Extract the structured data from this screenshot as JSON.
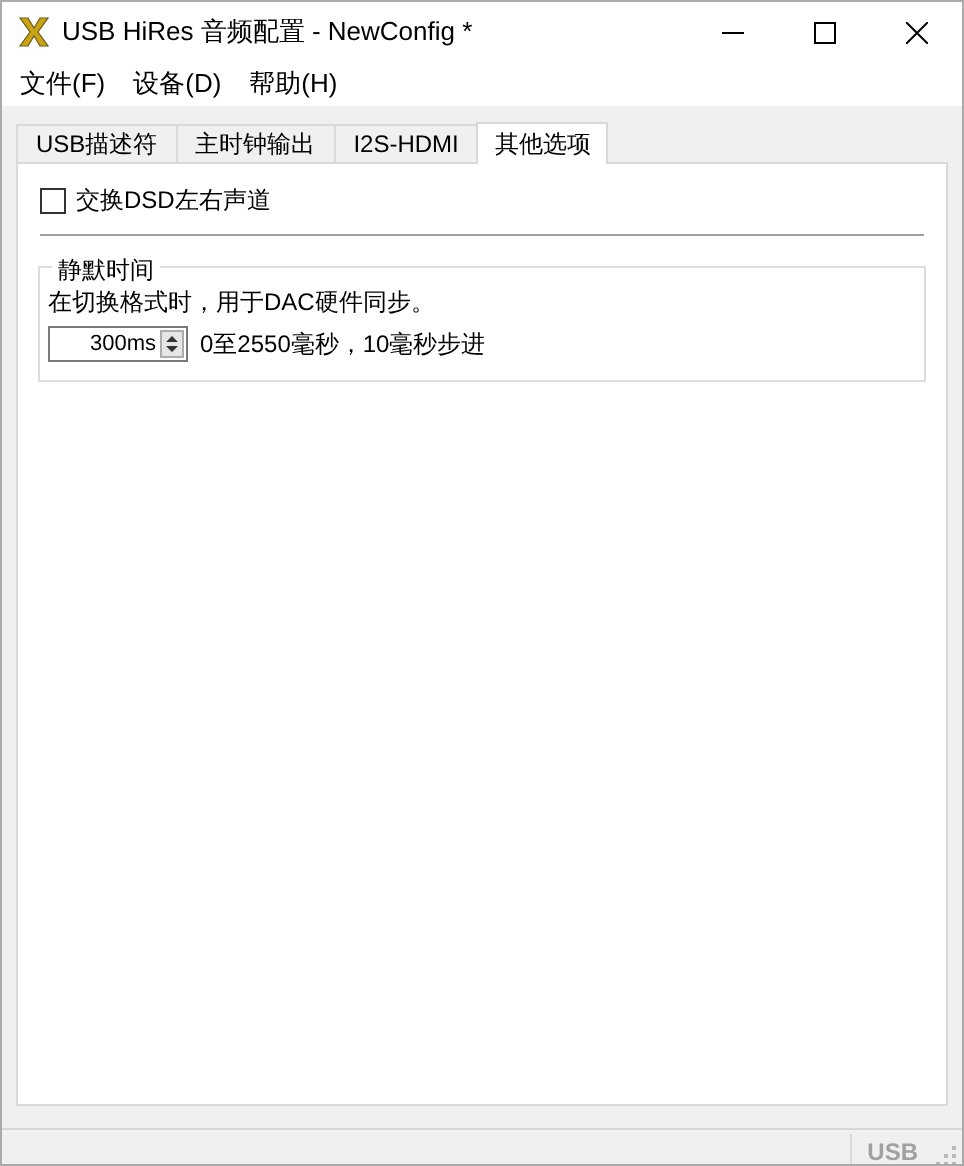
{
  "window": {
    "title": "USB HiRes 音频配置 - NewConfig *"
  },
  "menu": [
    "文件(F)",
    "设备(D)",
    "帮助(H)"
  ],
  "tabs": [
    {
      "label": "USB描述符",
      "selected": false
    },
    {
      "label": "主时钟输出",
      "selected": false
    },
    {
      "label": "I2S-HDMI",
      "selected": false
    },
    {
      "label": "其他选项",
      "selected": true
    }
  ],
  "swap_dsd": {
    "label": "交换DSD左右声道",
    "checked": false
  },
  "mute_group": {
    "title": "静默时间",
    "description": "在切换格式时，用于DAC硬件同步。",
    "value": "300ms",
    "hint": "0至2550毫秒，10毫秒步进"
  },
  "status_bar": {
    "text": "USB",
    "disabled": true
  }
}
